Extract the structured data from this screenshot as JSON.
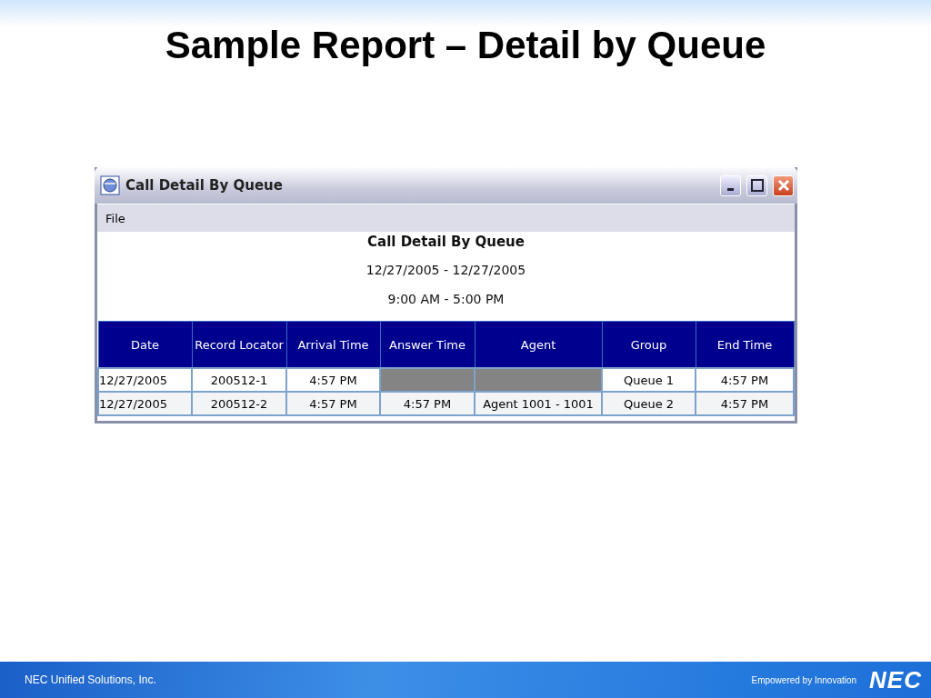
{
  "slide_title": "Sample Report – Detail by Queue",
  "window": {
    "title": "Call Detail By Queue",
    "menu": [
      "File"
    ],
    "report": {
      "title": "Call Detail By Queue",
      "date_range": "12/27/2005 - 12/27/2005",
      "time_range": "9:00 AM - 5:00 PM"
    },
    "table": {
      "columns": [
        "Date",
        "Record Locator",
        "Arrival Time",
        "Answer Time",
        "Agent",
        "Group",
        "End Time"
      ],
      "rows": [
        [
          "12/27/2005",
          "200512-1",
          "4:57 PM",
          null,
          null,
          "Queue 1",
          "4:57 PM"
        ],
        [
          "12/27/2005",
          "200512-2",
          "4:57 PM",
          "4:57 PM",
          "Agent 1001 - 1001",
          "Queue 2",
          "4:57 PM"
        ]
      ]
    }
  },
  "footer": {
    "company": "NEC Unified Solutions, Inc.",
    "tagline": "Empowered by Innovation",
    "logo": "NEC"
  }
}
